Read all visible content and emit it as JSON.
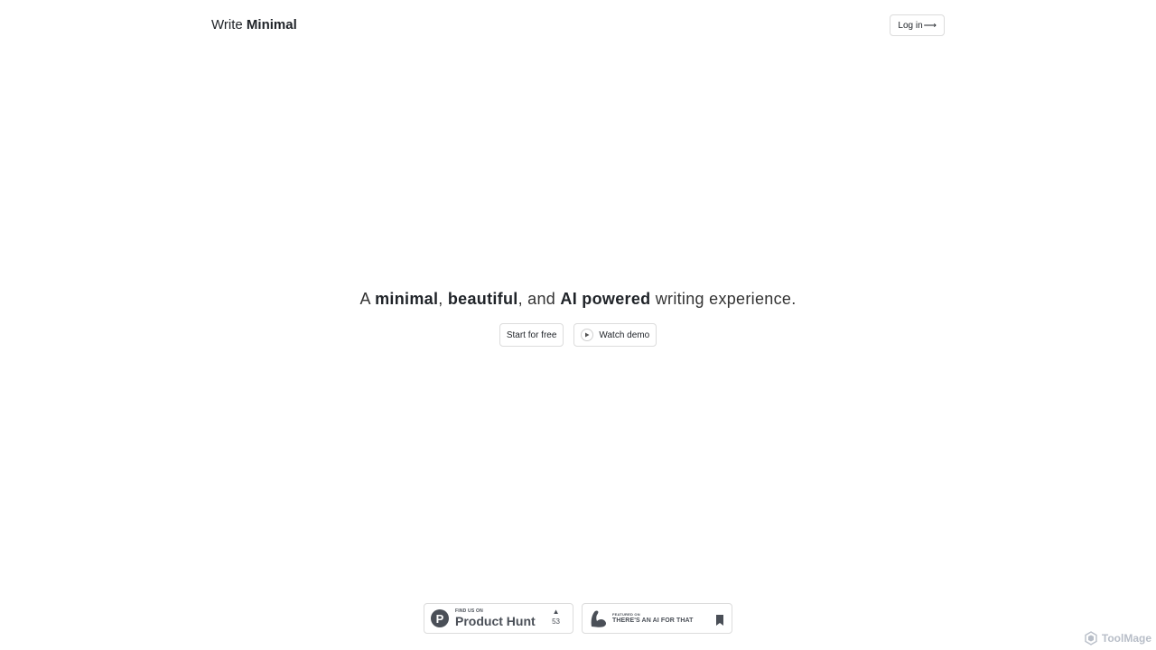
{
  "header": {
    "brand_light": "Write",
    "brand_bold": "Minimal",
    "login_label": "Log in",
    "login_arrow": "⟶"
  },
  "hero": {
    "tagline_parts": {
      "p1": "A ",
      "b1": "minimal",
      "p2": ", ",
      "b2": "beautiful",
      "p3": ", and ",
      "b3": "AI powered",
      "p4": " writing experience."
    },
    "start_label": "Start for free",
    "demo_label": "Watch demo"
  },
  "badges": {
    "product_hunt": {
      "small": "FIND US ON",
      "big": "Product Hunt",
      "votes": "53",
      "logo_letter": "P",
      "vote_arrow": "▲"
    },
    "ai_for_that": {
      "small": "FEATURED ON",
      "big": "THERE'S AN AI FOR THAT"
    }
  },
  "watermark": {
    "text": "ToolMage"
  },
  "colors": {
    "text": "#1f2328",
    "border": "#dcdcdc",
    "badge_dark": "#4a4f57",
    "watermark": "#b8bec8"
  }
}
